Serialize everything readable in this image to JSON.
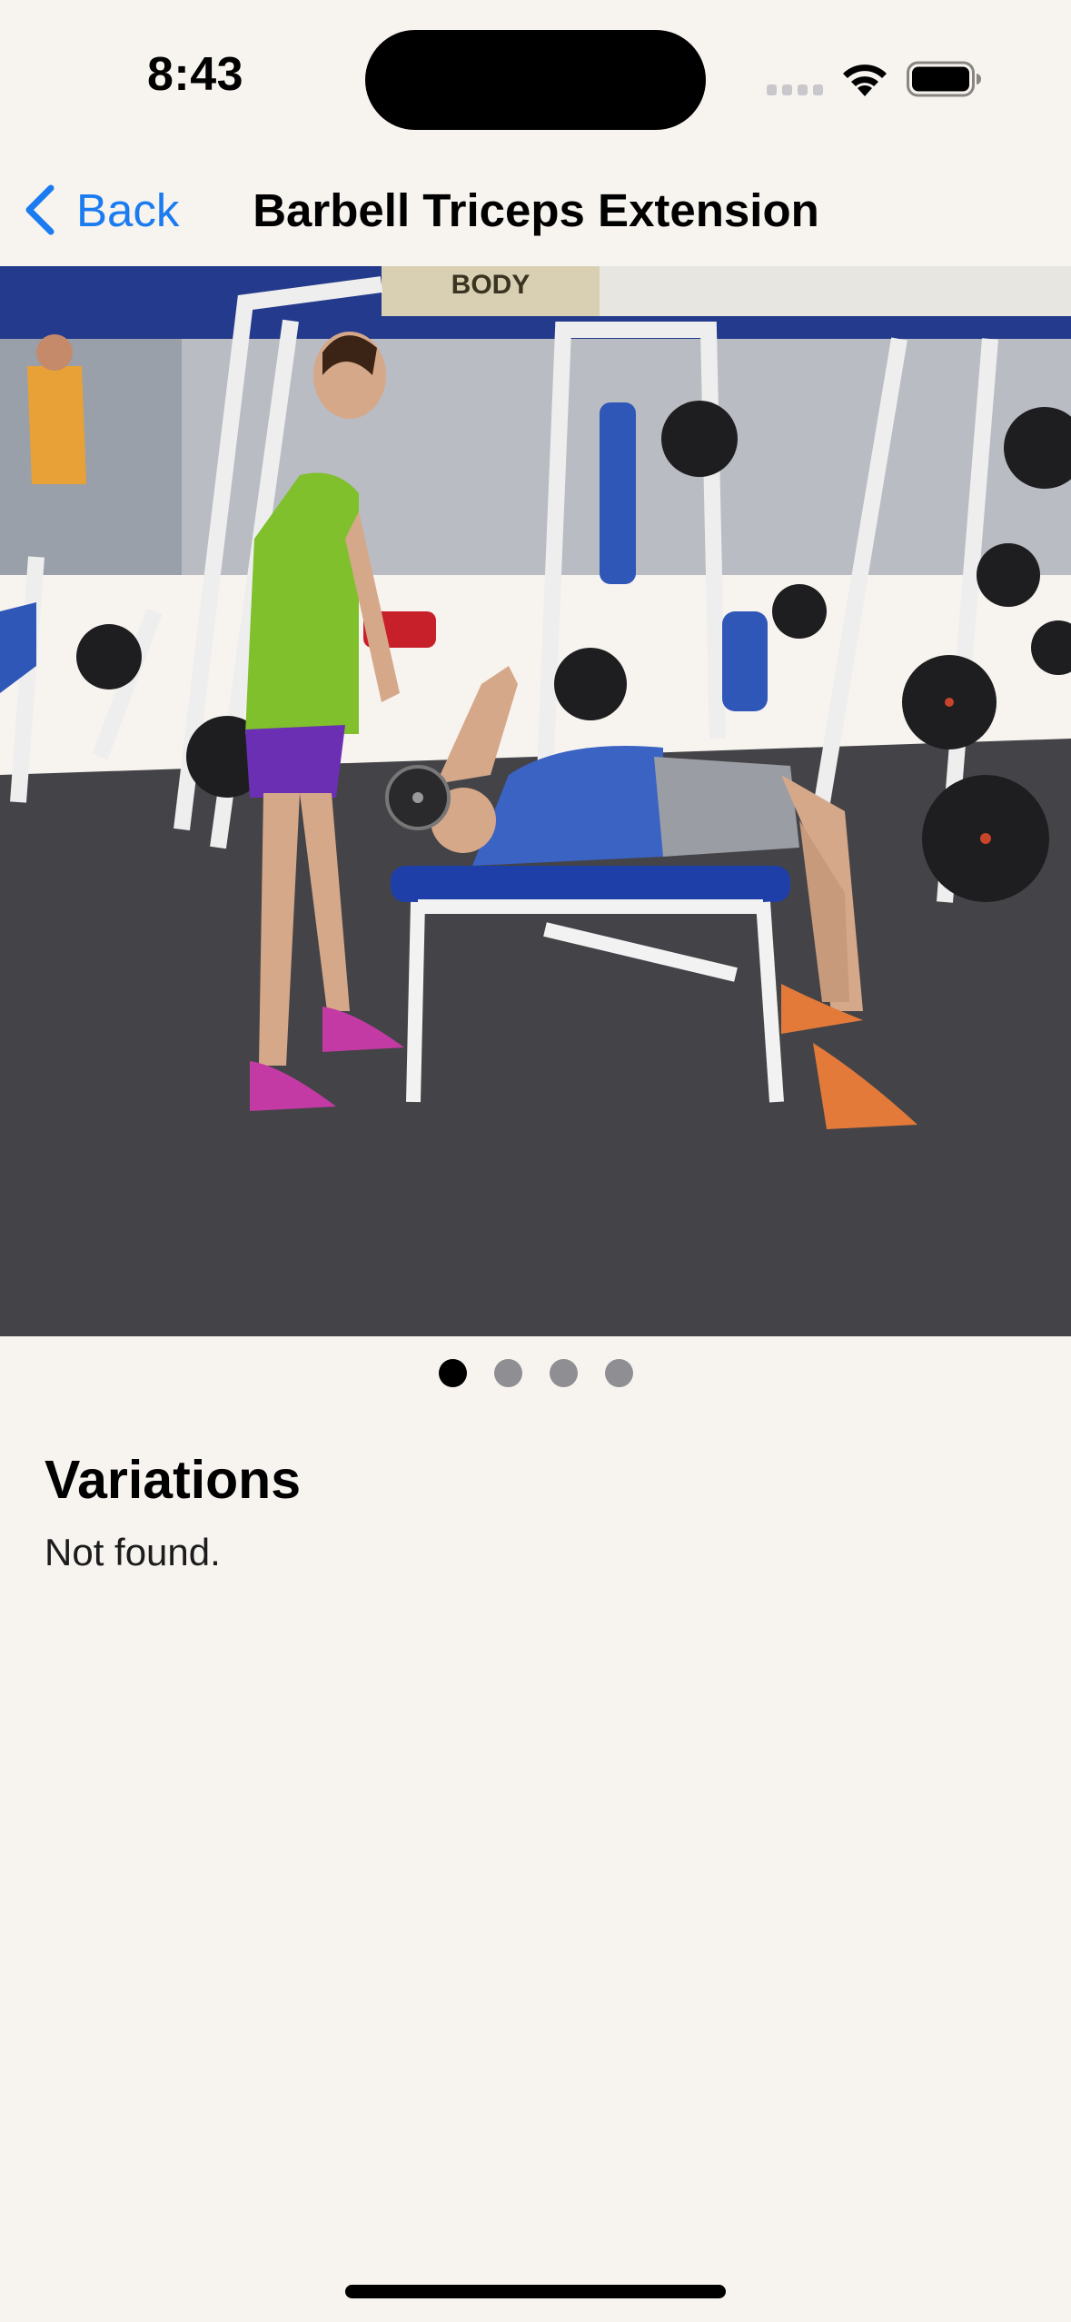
{
  "status_bar": {
    "time": "8:43"
  },
  "nav": {
    "back_label": "Back",
    "title": "Barbell Triceps Extension"
  },
  "carousel": {
    "image_description": "Woman spotting a man doing a lying barbell triceps extension on a blue bench in a gym",
    "sign_text": "BODY",
    "page_count": 4,
    "active_page": 1
  },
  "variations": {
    "title": "Variations",
    "text": "Not found."
  }
}
